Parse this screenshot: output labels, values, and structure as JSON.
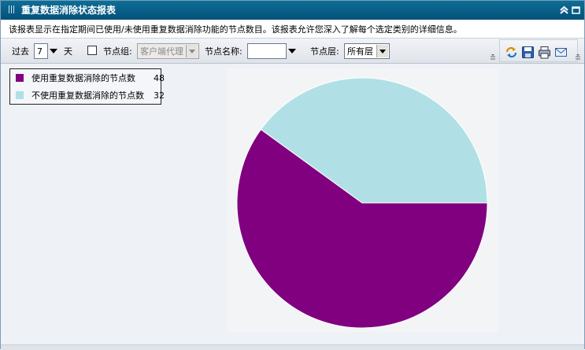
{
  "window": {
    "title": "重复数据消除状态报表",
    "collapse_icon": "double-chevron-up-icon",
    "maximize_icon": "maximize-icon"
  },
  "description": "该报表显示在指定期间已使用/未使用重复数据消除功能的节点数目。该报表允许您深入了解每个选定类别的详细信息。",
  "filters": {
    "period_prefix": "过去",
    "period_value": "7",
    "period_unit": "天",
    "node_group_label": "节点组:",
    "node_group_value": "客户端代理",
    "node_group_checked": false,
    "node_name_label": "节点名称:",
    "node_name_value": "",
    "node_tier_label": "节点层:",
    "node_tier_value": "所有层"
  },
  "tools": [
    "refresh-icon",
    "save-icon",
    "print-icon",
    "email-icon"
  ],
  "legend": [
    {
      "label": "使用重复数据消除的节点数",
      "value": "48",
      "color": "#800080"
    },
    {
      "label": "不使用重复数据消除的节点数",
      "value": "32",
      "color": "#b0e0e6"
    }
  ],
  "chart_data": {
    "type": "pie",
    "categories": [
      "使用重复数据消除的节点数",
      "不使用重复数据消除的节点数"
    ],
    "values": [
      48,
      32
    ],
    "colors": [
      "#800080",
      "#b0e0e6"
    ]
  }
}
